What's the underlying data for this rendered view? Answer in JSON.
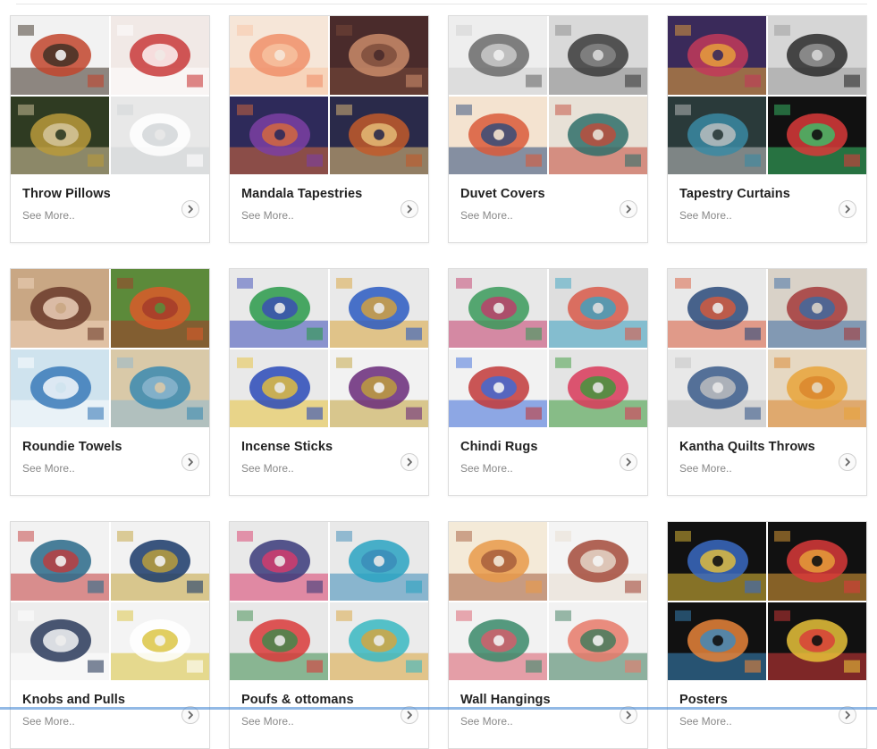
{
  "page": {
    "more_label": "See More.."
  },
  "categories": [
    {
      "title": "Throw Pillows",
      "more": "See More..",
      "tiles": [
        [
          "#f2f2f2",
          "#c2452d",
          "#3a2d22"
        ],
        [
          "#f1e9e6",
          "#c93a3a",
          "#ffffff"
        ],
        [
          "#2f3b22",
          "#b89a3b",
          "#d8c9a2"
        ],
        [
          "#e8e8e8",
          "#ffffff",
          "#cfd3d6"
        ]
      ]
    },
    {
      "title": "Mandala Tapestries",
      "more": "See More..",
      "tiles": [
        [
          "#f6e6d8",
          "#f08f6a",
          "#f7c4a3"
        ],
        [
          "#4a2b2b",
          "#c98b6a",
          "#7a4a3a"
        ],
        [
          "#2e2a5a",
          "#7b3fa3",
          "#d96a3a"
        ],
        [
          "#2a2a4a",
          "#c25a2a",
          "#e8c27a"
        ]
      ]
    },
    {
      "title": "Duvet Covers",
      "more": "See More..",
      "tiles": [
        [
          "#eeeeee",
          "#6a6a6a",
          "#d0d0d0"
        ],
        [
          "#d9d9d9",
          "#3a3a3a",
          "#8a8a8a"
        ],
        [
          "#f4e3d0",
          "#d95a3a",
          "#2a4a7a"
        ],
        [
          "#e8e1d7",
          "#2f6e6a",
          "#c24a3a"
        ]
      ]
    },
    {
      "title": "Tapestry Curtains",
      "more": "See More..",
      "tiles": [
        [
          "#3a2a5a",
          "#c23a5a",
          "#e8a43a"
        ],
        [
          "#d6d6d6",
          "#2a2a2a",
          "#9a9a9a"
        ],
        [
          "#2a3a3a",
          "#3a8aa3",
          "#c2c2c2"
        ],
        [
          "#111111",
          "#d93a3a",
          "#3ac26a"
        ]
      ]
    },
    {
      "title": "Roundie Towels",
      "more": "See More..",
      "tiles": [
        [
          "#c9a784",
          "#6a3a2a",
          "#f2d7c0"
        ],
        [
          "#5c8a3a",
          "#d95a2a",
          "#a33a2a"
        ],
        [
          "#cfe3ee",
          "#3a7ab8",
          "#ffffff"
        ],
        [
          "#d9c9a8",
          "#3a8ab0",
          "#8fb8d0"
        ]
      ]
    },
    {
      "title": "Incense Sticks",
      "more": "See More..",
      "tiles": [
        [
          "#e9e9e9",
          "#2a9a4a",
          "#3a4ab8"
        ],
        [
          "#e9e9e9",
          "#2a5ac2",
          "#d9a43a"
        ],
        [
          "#e9e9e9",
          "#2a4ab8",
          "#e8c23a"
        ],
        [
          "#f2f2f2",
          "#6a2a7a",
          "#c2a23a"
        ]
      ]
    },
    {
      "title": "Chindi Rugs",
      "more": "See More..",
      "tiles": [
        [
          "#e8e8e8",
          "#3a9a5a",
          "#c23a6a"
        ],
        [
          "#dedede",
          "#d95a4a",
          "#3aa3c2"
        ],
        [
          "#f2f2f2",
          "#c23a3a",
          "#3a6ad9"
        ],
        [
          "#e4e4e4",
          "#d93a5a",
          "#3a9a3a"
        ]
      ]
    },
    {
      "title": "Kantha Quilts Throws",
      "more": "See More..",
      "tiles": [
        [
          "#e9e9e9",
          "#2a4a7a",
          "#d95a3a"
        ],
        [
          "#d9d2c8",
          "#a33a3a",
          "#3a6aa3"
        ],
        [
          "#e8e8e8",
          "#3a5a8a",
          "#c2c2c2"
        ],
        [
          "#e6d8c2",
          "#e8a43a",
          "#d9842a"
        ]
      ]
    },
    {
      "title": "Knobs and Pulls",
      "more": "See More..",
      "tiles": [
        [
          "#f2f2f2",
          "#2a6a8a",
          "#c23a3a"
        ],
        [
          "#f2f2f2",
          "#1a3a6a",
          "#c2a23a"
        ],
        [
          "#ededed",
          "#2a3a5a",
          "#ffffff"
        ],
        [
          "#f4f4f4",
          "#ffffff",
          "#d9c23a"
        ]
      ]
    },
    {
      "title": "Poufs & ottomans",
      "more": "See More..",
      "tiles": [
        [
          "#e9e9e9",
          "#3a3a7a",
          "#d93a6a"
        ],
        [
          "#e9e9e9",
          "#2aa3c2",
          "#3a8ab8"
        ],
        [
          "#e8e8e8",
          "#d93a3a",
          "#3a8a4a"
        ],
        [
          "#ebebeb",
          "#3ab8c2",
          "#d9a43a"
        ]
      ]
    },
    {
      "title": "Wall Hangings",
      "more": "See More..",
      "tiles": [
        [
          "#f4ead8",
          "#e89a4a",
          "#a35a3a"
        ],
        [
          "#f4f4f4",
          "#a34a3a",
          "#e8ddd0"
        ],
        [
          "#f2f2f2",
          "#3a8a6a",
          "#d95a6a"
        ],
        [
          "#f2f2f2",
          "#e87a6a",
          "#3a7a5a"
        ]
      ]
    },
    {
      "title": "Posters",
      "more": "See More..",
      "tiles": [
        [
          "#111111",
          "#3a6ac2",
          "#e8c23a"
        ],
        [
          "#111111",
          "#d93a3a",
          "#e8a43a"
        ],
        [
          "#111111",
          "#e8843a",
          "#3a8ac2"
        ],
        [
          "#111111",
          "#e8c23a",
          "#d93a3a"
        ]
      ]
    }
  ],
  "icons": {
    "arrow": "chevron-right-icon"
  }
}
